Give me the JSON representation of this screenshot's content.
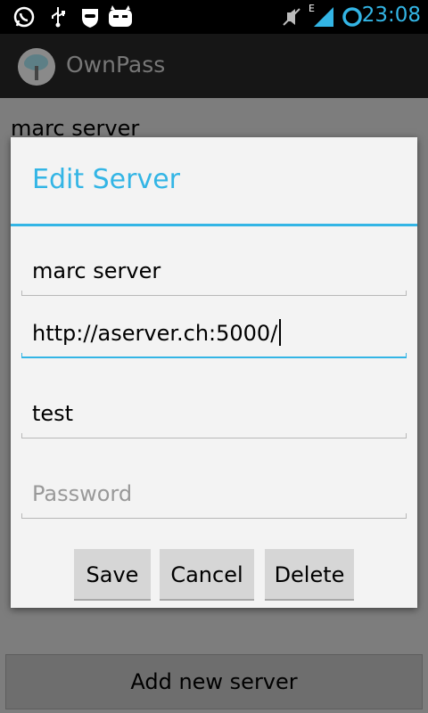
{
  "status_bar": {
    "time": "23:08",
    "icons": [
      "whatsapp-icon",
      "usb-icon",
      "privacy-guard-icon",
      "cyanogenmod-icon",
      "mute-icon",
      "edge-signal-icon",
      "sync-ring-icon"
    ],
    "network_label": "E"
  },
  "action_bar": {
    "title": "OwnPass",
    "icon": "cloud-tree-icon"
  },
  "list": {
    "items": [
      {
        "label": "marc server"
      }
    ],
    "add_button_label": "Add new server"
  },
  "dialog": {
    "title": "Edit Server",
    "fields": [
      {
        "value": "marc server",
        "placeholder": ""
      },
      {
        "value": "http://aserver.ch:5000/",
        "placeholder": ""
      },
      {
        "value": "test",
        "placeholder": ""
      },
      {
        "value": "",
        "placeholder": "Password"
      }
    ],
    "buttons": {
      "save": "Save",
      "cancel": "Cancel",
      "delete": "Delete"
    }
  },
  "colors": {
    "accent": "#33b5e5",
    "dialog_bg": "#f3f3f3"
  }
}
